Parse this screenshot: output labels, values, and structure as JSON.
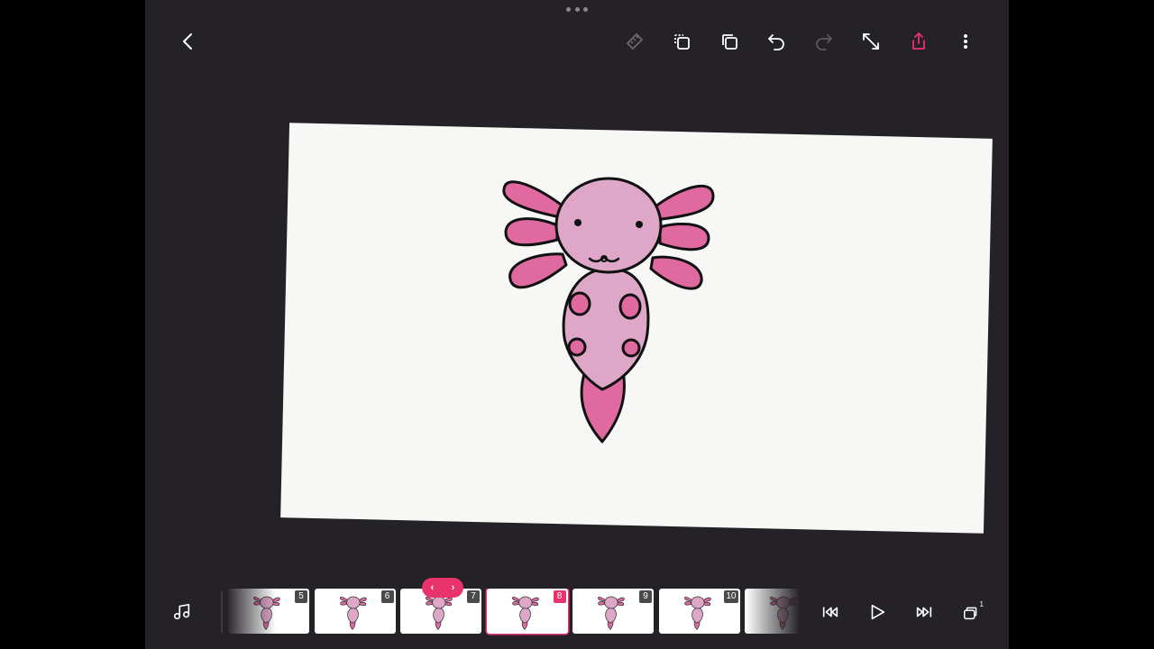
{
  "colors": {
    "accent": "#e8336c",
    "icon": "#ffffff",
    "icon_disabled": "#6a686c",
    "background": "#242226",
    "canvas": "#f7f7f6",
    "axolotl_gills": "#e06aa0",
    "axolotl_body": "#dea6c7"
  },
  "toolbar": {
    "icons": [
      "back-icon",
      "ruler-icon",
      "duplicate-frame-icon",
      "copy-icon",
      "undo-icon",
      "redo-icon",
      "fullscreen-icon",
      "share-icon",
      "more-icon"
    ]
  },
  "timeline": {
    "frames": [
      {
        "number": "5",
        "selected": false
      },
      {
        "number": "6",
        "selected": false
      },
      {
        "number": "7",
        "selected": false
      },
      {
        "number": "8",
        "selected": true
      },
      {
        "number": "9",
        "selected": false
      },
      {
        "number": "10",
        "selected": false
      },
      {
        "number": "",
        "selected": false
      }
    ],
    "nav_prev": "‹",
    "nav_next": "›"
  },
  "playback": {
    "icons": [
      "music-icon",
      "skip-back-icon",
      "play-icon",
      "skip-forward-icon",
      "layers-icon"
    ],
    "layers_count": "1"
  }
}
